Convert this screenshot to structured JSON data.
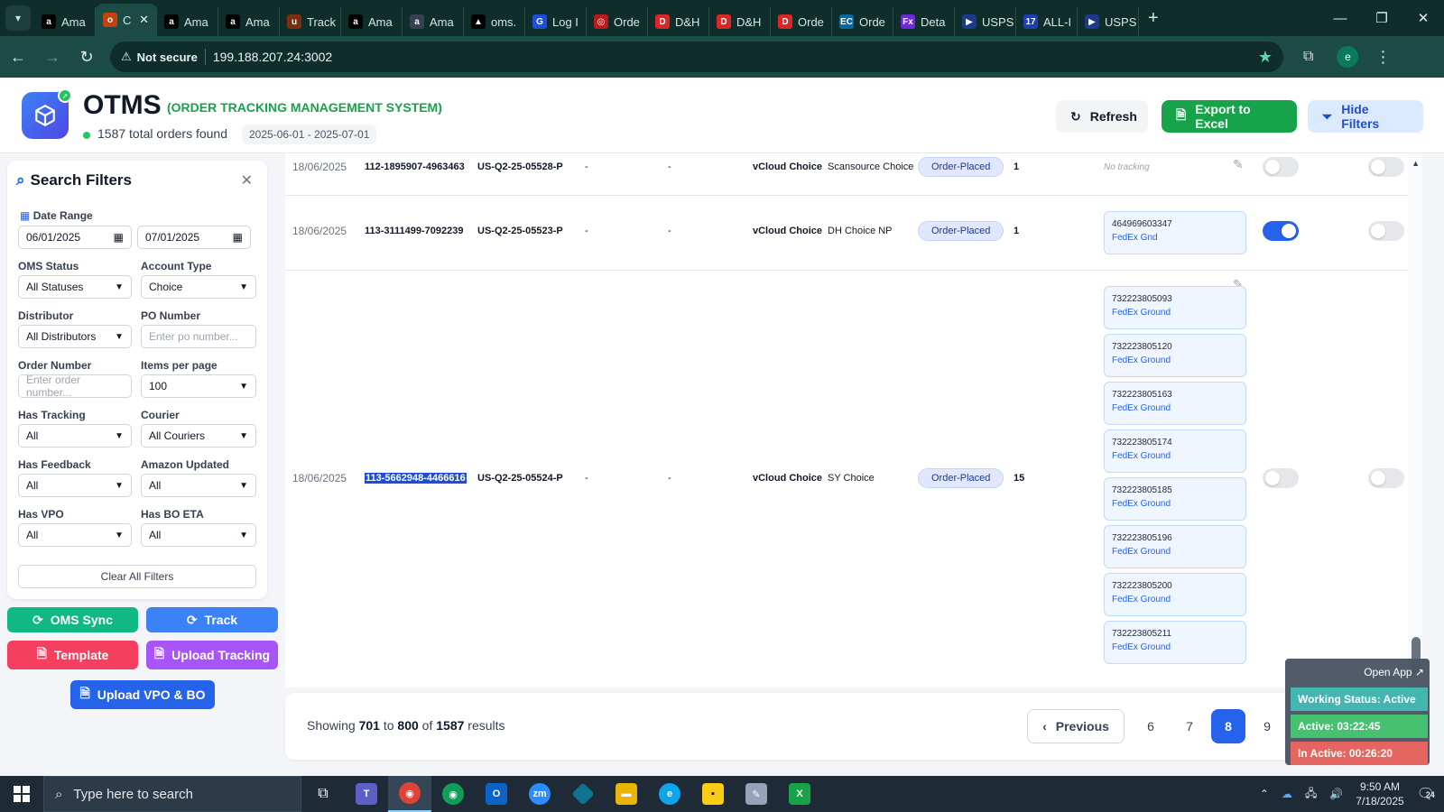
{
  "browser": {
    "tabs": [
      {
        "label": "Ama",
        "fav_color": "#000000",
        "glyph": "a"
      },
      {
        "label": "C",
        "fav_color": "#c2410c",
        "glyph": "o",
        "active": true
      },
      {
        "label": "Ama",
        "fav_color": "#000000",
        "glyph": "a"
      },
      {
        "label": "Ama",
        "fav_color": "#000000",
        "glyph": "a"
      },
      {
        "label": "Track",
        "fav_color": "#7c2d12",
        "glyph": "u"
      },
      {
        "label": "Ama",
        "fav_color": "#000000",
        "glyph": "a"
      },
      {
        "label": "Ama",
        "fav_color": "#374151",
        "glyph": "a"
      },
      {
        "label": "oms.",
        "fav_color": "#000000",
        "glyph": "▲"
      },
      {
        "label": "Log I",
        "fav_color": "#1d4ed8",
        "glyph": "G"
      },
      {
        "label": "Orde",
        "fav_color": "#b91c1c",
        "glyph": "◎"
      },
      {
        "label": "D&H",
        "fav_color": "#dc2626",
        "glyph": "D"
      },
      {
        "label": "D&H",
        "fav_color": "#dc2626",
        "glyph": "D"
      },
      {
        "label": "Orde",
        "fav_color": "#dc2626",
        "glyph": "D"
      },
      {
        "label": "Orde",
        "fav_color": "#0369a1",
        "glyph": "EC"
      },
      {
        "label": "Deta",
        "fav_color": "#6d28d9",
        "glyph": "Fx"
      },
      {
        "label": "USPS",
        "fav_color": "#1e3a8a",
        "glyph": "▶"
      },
      {
        "label": "ALL-I",
        "fav_color": "#1e40af",
        "glyph": "17"
      },
      {
        "label": "USPS",
        "fav_color": "#1e3a8a",
        "glyph": "▶"
      }
    ],
    "security_label": "Not secure",
    "url": "199.188.207.24:3002",
    "profile_initial": "e"
  },
  "header": {
    "title": "OTMS",
    "subtitle": "(ORDER TRACKING MANAGEMENT SYSTEM)",
    "total_orders": "1587 total orders found",
    "date_range": "2025-06-01 - 2025-07-01",
    "refresh_label": "Refresh",
    "export_label": "Export to Excel",
    "hide_filters_label": "Hide Filters"
  },
  "filters": {
    "title": "Search Filters",
    "date_range_label": "Date Range",
    "date_from": "06/01/2025",
    "date_to": "07/01/2025",
    "oms_status_label": "OMS Status",
    "oms_status_value": "All Statuses",
    "account_type_label": "Account Type",
    "account_type_value": "Choice",
    "distributor_label": "Distributor",
    "distributor_value": "All Distributors",
    "po_number_label": "PO Number",
    "po_number_placeholder": "Enter po number...",
    "order_number_label": "Order Number",
    "order_number_placeholder": "Enter order number...",
    "items_per_page_label": "Items per page",
    "items_per_page_value": "100",
    "has_tracking_label": "Has Tracking",
    "has_tracking_value": "All",
    "courier_label": "Courier",
    "courier_value": "All Couriers",
    "has_feedback_label": "Has Feedback",
    "has_feedback_value": "All",
    "amazon_updated_label": "Amazon Updated",
    "amazon_updated_value": "All",
    "has_vpo_label": "Has VPO",
    "has_vpo_value": "All",
    "has_bo_eta_label": "Has BO ETA",
    "has_bo_eta_value": "All",
    "clear_label": "Clear All Filters"
  },
  "actions": {
    "oms_sync": "OMS Sync",
    "track": "Track",
    "template": "Template",
    "upload_tracking": "Upload Tracking",
    "upload_vpo_bo": "Upload VPO & BO",
    "colors": {
      "oms_sync": "#10b981",
      "track": "#3b82f6",
      "template": "#f43f5e",
      "upload_tracking": "#a855f7",
      "upload_vpo_bo": "#2563eb"
    }
  },
  "orders": [
    {
      "date": "18/06/2025",
      "order_no": "112-1895907-4963463",
      "po": "US-Q2-25-05528-P",
      "col4": "-",
      "col5": "-",
      "account": "vCloud Choice",
      "distributor": "Scansource Choice",
      "status": "Order-Placed",
      "qty": "1",
      "no_tracking": "No tracking",
      "tracking": [],
      "toggle1": false,
      "toggle2": false
    },
    {
      "date": "18/06/2025",
      "order_no": "113-3111499-7092239",
      "po": "US-Q2-25-05523-P",
      "col4": "-",
      "col5": "-",
      "account": "vCloud Choice",
      "distributor": "DH Choice NP",
      "status": "Order-Placed",
      "qty": "1",
      "tracking": [
        {
          "number": "464969603347",
          "courier": "FedEx Gnd"
        }
      ],
      "toggle1": true,
      "toggle2": false
    },
    {
      "date": "18/06/2025",
      "order_no": "113-5662948-4466616",
      "po": "US-Q2-25-05524-P",
      "col4": "-",
      "col5": "-",
      "account": "vCloud Choice",
      "distributor": "SY Choice",
      "status": "Order-Placed",
      "qty": "15",
      "tracking": [
        {
          "number": "732223805093",
          "courier": "FedEx Ground"
        },
        {
          "number": "732223805120",
          "courier": "FedEx Ground"
        },
        {
          "number": "732223805163",
          "courier": "FedEx Ground"
        },
        {
          "number": "732223805174",
          "courier": "FedEx Ground"
        },
        {
          "number": "732223805185",
          "courier": "FedEx Ground"
        },
        {
          "number": "732223805196",
          "courier": "FedEx Ground"
        },
        {
          "number": "732223805200",
          "courier": "FedEx Ground"
        },
        {
          "number": "732223805211",
          "courier": "FedEx Ground"
        }
      ],
      "toggle1": false,
      "toggle2": false
    }
  ],
  "pagination": {
    "showing_prefix": "Showing",
    "from": "701",
    "to_word": "to",
    "to": "800",
    "of_word": "of",
    "total": "1587",
    "results_word": "results",
    "previous_label": "Previous",
    "pages": [
      "6",
      "7",
      "8",
      "9"
    ],
    "current_page": "8"
  },
  "widget": {
    "open_app": "Open App ↗",
    "working_status": "Working Status: Active",
    "active_time": "Active: 03:22:45",
    "inactive_time": "In Active: 00:26:20"
  },
  "taskbar": {
    "search_placeholder": "Type here to search",
    "time": "9:50 AM",
    "date": "7/18/2025",
    "notif_count": "24"
  }
}
